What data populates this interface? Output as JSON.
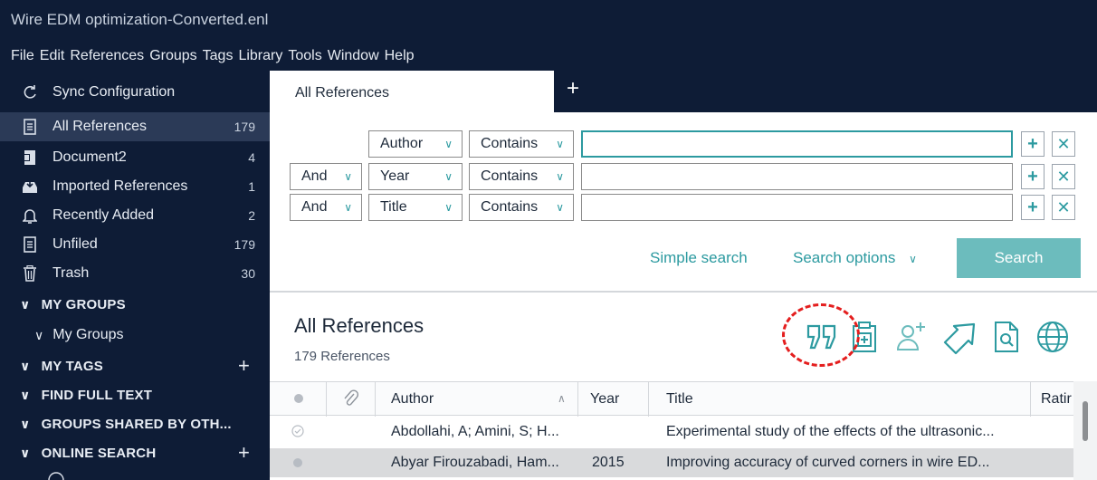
{
  "window": {
    "title": "Wire EDM optimization-Converted.enl"
  },
  "menu": [
    "File",
    "Edit",
    "References",
    "Groups",
    "Tags",
    "Library",
    "Tools",
    "Window",
    "Help"
  ],
  "sidebar": {
    "sync": "Sync Configuration",
    "items": [
      {
        "label": "All References",
        "count": "179",
        "icon": "document-icon"
      },
      {
        "label": "Document2",
        "count": "4",
        "icon": "word-document-icon"
      },
      {
        "label": "Imported References",
        "count": "1",
        "icon": "import-icon"
      },
      {
        "label": "Recently Added",
        "count": "2",
        "icon": "bell-icon"
      },
      {
        "label": "Unfiled",
        "count": "179",
        "icon": "document-icon"
      },
      {
        "label": "Trash",
        "count": "30",
        "icon": "trash-icon"
      }
    ],
    "my_groups": "MY GROUPS",
    "my_groups_child": "My Groups",
    "my_tags": "MY TAGS",
    "find_full_text": "FIND FULL TEXT",
    "groups_shared": "GROUPS SHARED BY OTH...",
    "online_search": "ONLINE SEARCH"
  },
  "tabs": {
    "active": "All References",
    "add": "+"
  },
  "search": {
    "rows": [
      {
        "connector": "",
        "field": "Author",
        "op": "Contains",
        "value": ""
      },
      {
        "connector": "And",
        "field": "Year",
        "op": "Contains",
        "value": ""
      },
      {
        "connector": "And",
        "field": "Title",
        "op": "Contains",
        "value": ""
      }
    ],
    "simple_search": "Simple search",
    "search_options": "Search options",
    "search_button": "Search"
  },
  "list": {
    "title": "All References",
    "count": "179 References",
    "columns": {
      "author": "Author",
      "year": "Year",
      "title": "Title",
      "rating": "Ratir"
    },
    "rows": [
      {
        "author": "Abdollahi, A; Amini, S; H...",
        "year": "",
        "title": "Experimental study of the effects of the ultrasonic..."
      },
      {
        "author": "Abyar Firouzabadi, Ham...",
        "year": "2015",
        "title": "Improving accuracy of curved corners in wire ED..."
      }
    ]
  },
  "colors": {
    "accent": "#2c9aa0",
    "sidebar_bg": "#0e1c36",
    "selected_bg": "#2b3a57",
    "highlight": "#e41e1e"
  }
}
